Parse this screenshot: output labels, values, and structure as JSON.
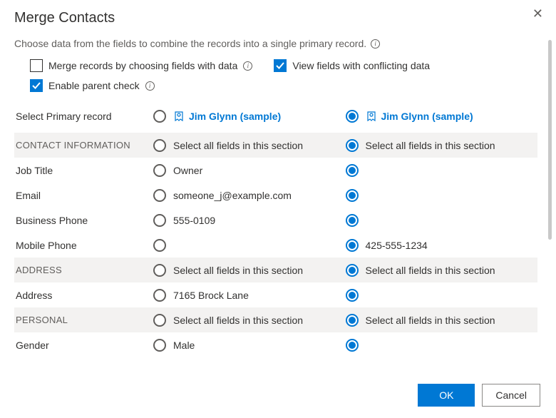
{
  "dialog": {
    "title": "Merge Contacts",
    "subtitle": "Choose data from the fields to combine the records into a single primary record."
  },
  "options": {
    "merge_by_fields": {
      "label": "Merge records by choosing fields with data",
      "checked": false
    },
    "view_conflicting": {
      "label": "View fields with conflicting data",
      "checked": true
    },
    "enable_parent_check": {
      "label": "Enable parent check",
      "checked": true
    }
  },
  "primary_record": {
    "label": "Select Primary record",
    "record_a": "Jim Glynn (sample)",
    "record_b": "Jim Glynn (sample)",
    "selected": "b"
  },
  "select_all_label": "Select all fields in this section",
  "sections": [
    {
      "title": "CONTACT INFORMATION",
      "rows": [
        {
          "label": "Job Title",
          "a": "Owner",
          "b": ""
        },
        {
          "label": "Email",
          "a": "someone_j@example.com",
          "b": ""
        },
        {
          "label": "Business Phone",
          "a": "555-0109",
          "b": ""
        },
        {
          "label": "Mobile Phone",
          "a": "",
          "b": "425-555-1234"
        }
      ]
    },
    {
      "title": "ADDRESS",
      "rows": [
        {
          "label": "Address",
          "a": "7165 Brock Lane",
          "b": ""
        }
      ]
    },
    {
      "title": "PERSONAL",
      "rows": [
        {
          "label": "Gender",
          "a": "Male",
          "b": ""
        }
      ]
    }
  ],
  "footer": {
    "ok": "OK",
    "cancel": "Cancel"
  }
}
